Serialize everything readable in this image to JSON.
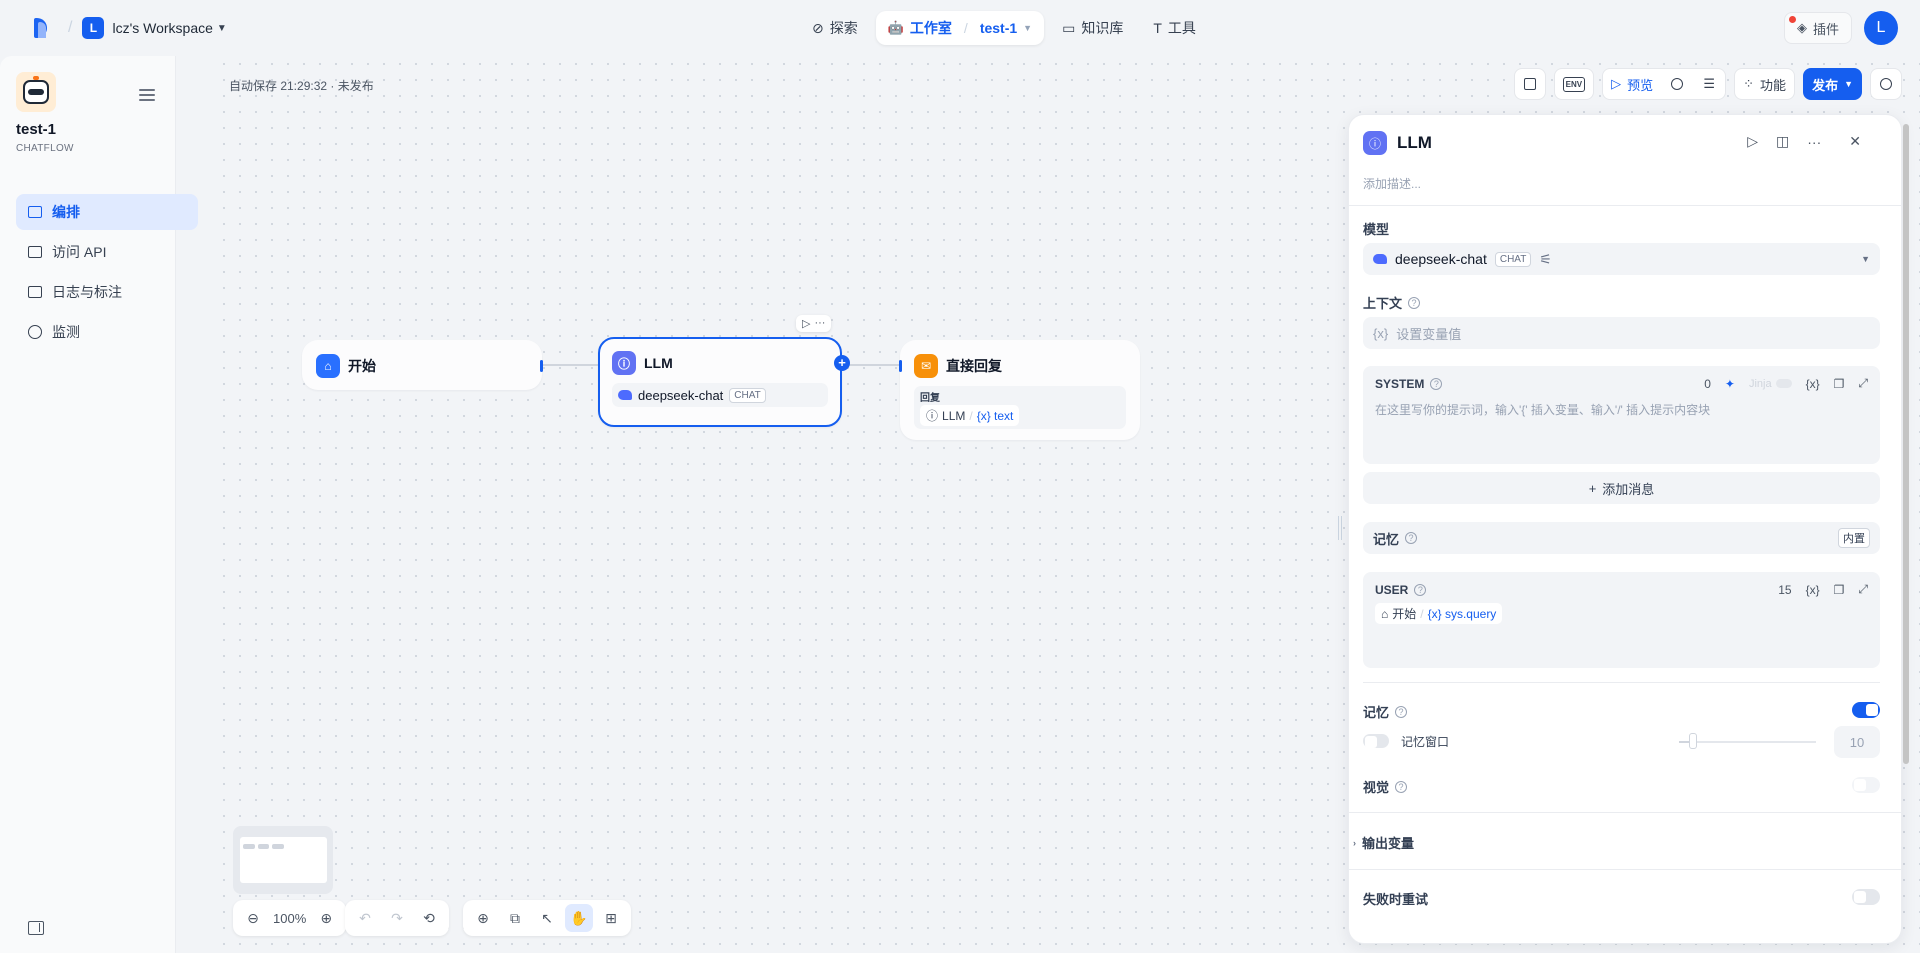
{
  "topbar": {
    "workspace_initial": "L",
    "workspace_name": "lcz's Workspace",
    "nav": {
      "explore": "探索",
      "studio": "工作室",
      "app": "test-1",
      "knowledge": "知识库",
      "tools": "工具"
    },
    "plugins": "插件",
    "user_initial": "L"
  },
  "sidebar": {
    "app_name": "test-1",
    "app_type": "CHATFLOW",
    "items": [
      {
        "label": "编排"
      },
      {
        "label": "访问 API"
      },
      {
        "label": "日志与标注"
      },
      {
        "label": "监测"
      }
    ]
  },
  "canvas": {
    "autosave": "自动保存 21:29:32 · 未发布",
    "toolbar": {
      "env": "ENV",
      "preview": "预览",
      "features": "功能",
      "publish": "发布"
    },
    "nodes": {
      "start": {
        "title": "开始"
      },
      "llm": {
        "title": "LLM",
        "model": "deepseek-chat",
        "model_tag": "CHAT"
      },
      "answer": {
        "title": "直接回复",
        "reply_label": "回复",
        "ref_node": "LLM",
        "ref_var": "{x} text"
      }
    },
    "zoom": "100%"
  },
  "panel": {
    "title": "LLM",
    "description_placeholder": "添加描述...",
    "model_label": "模型",
    "model_name": "deepseek-chat",
    "model_tag": "CHAT",
    "context_label": "上下文",
    "context_placeholder": "设置变量值",
    "system": {
      "role": "SYSTEM",
      "count": "0",
      "jinja": "Jinja",
      "placeholder": "在这里写你的提示词，输入'{' 插入变量、输入'/' 插入提示内容块"
    },
    "add_message": "添加消息",
    "memory_inline": {
      "label": "记忆",
      "badge": "内置"
    },
    "user": {
      "role": "USER",
      "count": "15",
      "ref_node": "开始",
      "ref_var": "{x} sys.query"
    },
    "memory_label": "记忆",
    "memory_enabled": true,
    "memory_window_label": "记忆窗口",
    "memory_window_value": "10",
    "vision_label": "视觉",
    "output_vars_label": "输出变量",
    "retry_label": "失败时重试"
  }
}
